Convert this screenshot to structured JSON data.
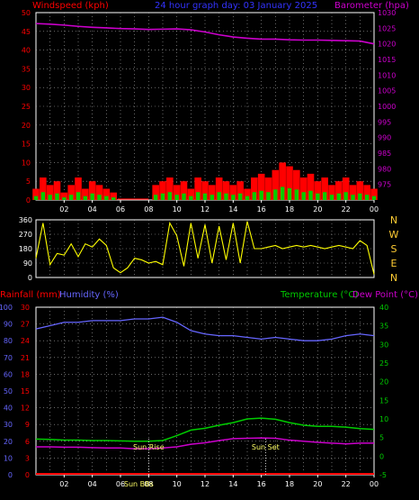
{
  "header": {
    "windspeed_label": "Windspeed (kph)",
    "graph_title": "24 hour graph day: 03 January 2025",
    "barometer_label": "Barometer (hpa)",
    "rainfall_label": "Rainfall (mm)",
    "humidity_label": "Humidity (%)",
    "temperature_label": "Temperature (°C)",
    "dewpoint_label": "Dew Point (°C)",
    "sunrise_label": "Sun Rise",
    "sunset_label": "Sun Set",
    "sunbbs_label": "Sun BBs"
  },
  "colors": {
    "background": "#000000",
    "wind": "#ff0000",
    "gust_fill": "#00cc00",
    "barometer": "#cc00cc",
    "direction": "#ffff00",
    "humidity": "#6666ff",
    "temperature": "#00cc00",
    "dewpoint": "#cc00cc",
    "rainfall": "#ff0000",
    "grid": "#aaaaaa",
    "axis": "#ffffff",
    "compass": "#ffcc33"
  },
  "chart_data": [
    {
      "type": "area",
      "title": "24 hour graph day: 03 January 2025",
      "ylabel": "Windspeed (kph)",
      "y2label": "Barometer (hpa)",
      "ylim": [
        0,
        50
      ],
      "y2lim": [
        970,
        1030
      ],
      "yticks": [
        "0",
        "5",
        "10",
        "15",
        "20",
        "25",
        "30",
        "35",
        "40",
        "45",
        "50"
      ],
      "y2ticks": [
        "975",
        "980",
        "985",
        "990",
        "995",
        "1000",
        "1005",
        "1010",
        "1015",
        "1020",
        "1025",
        "1030"
      ],
      "xticks": [
        "02",
        "04",
        "06",
        "08",
        "10",
        "12",
        "14",
        "16",
        "18",
        "20",
        "22",
        "00"
      ],
      "series": [
        {
          "name": "Windspeed (kph)",
          "x": [
            0,
            0.5,
            1,
            1.5,
            2,
            2.5,
            3,
            3.5,
            4,
            4.5,
            5,
            5.5,
            6,
            6.5,
            7,
            7.5,
            8,
            8.5,
            9,
            9.5,
            10,
            10.5,
            11,
            11.5,
            12,
            12.5,
            13,
            13.5,
            14,
            14.5,
            15,
            15.5,
            16,
            16.5,
            17,
            17.5,
            18,
            18.5,
            19,
            19.5,
            20,
            20.5,
            21,
            21.5,
            22,
            22.5,
            23,
            23.5,
            24
          ],
          "values": [
            3,
            6,
            4,
            5,
            2,
            4,
            6,
            3,
            5,
            4,
            3,
            2,
            0,
            0,
            0,
            0,
            0,
            4,
            5,
            6,
            4,
            5,
            3,
            6,
            5,
            4,
            6,
            5,
            4,
            5,
            3,
            6,
            7,
            6,
            8,
            10,
            9,
            8,
            6,
            7,
            5,
            6,
            4,
            5,
            6,
            4,
            5,
            4,
            3
          ]
        },
        {
          "name": "Barometer (hpa)",
          "x": [
            0,
            1,
            2,
            3,
            4,
            5,
            6,
            7,
            8,
            9,
            10,
            11,
            12,
            13,
            14,
            15,
            16,
            17,
            18,
            19,
            20,
            21,
            22,
            23,
            24
          ],
          "values": [
            1026.5,
            1026.3,
            1026.0,
            1025.6,
            1025.3,
            1025.1,
            1024.9,
            1024.8,
            1024.6,
            1024.7,
            1024.8,
            1024.5,
            1023.8,
            1022.9,
            1022.2,
            1021.8,
            1021.5,
            1021.5,
            1021.3,
            1021.2,
            1021.2,
            1021.1,
            1021.0,
            1020.9,
            1020.0
          ]
        }
      ]
    },
    {
      "type": "line",
      "ylabel": "Wind direction",
      "ylim": [
        0,
        360
      ],
      "yticks": [
        "0",
        "90",
        "180",
        "270",
        "360"
      ],
      "compass": [
        "N",
        "W",
        "S",
        "E",
        "N"
      ],
      "series": [
        {
          "name": "Wind direction",
          "x": [
            0,
            0.5,
            1,
            1.5,
            2,
            2.5,
            3,
            3.5,
            4,
            4.5,
            5,
            5.5,
            6,
            6.5,
            7,
            7.5,
            8,
            8.5,
            9,
            9.5,
            10,
            10.5,
            11,
            11.5,
            12,
            12.5,
            13,
            13.5,
            14,
            14.5,
            15,
            15.5,
            16,
            16.5,
            17,
            17.5,
            18,
            18.5,
            19,
            19.5,
            20,
            20.5,
            21,
            21.5,
            22,
            22.5,
            23,
            23.5,
            24
          ],
          "values": [
            120,
            340,
            80,
            150,
            140,
            210,
            130,
            210,
            190,
            240,
            200,
            60,
            30,
            60,
            120,
            110,
            90,
            100,
            80,
            340,
            260,
            70,
            340,
            120,
            330,
            90,
            320,
            110,
            340,
            90,
            350,
            180,
            180,
            190,
            200,
            180,
            190,
            200,
            190,
            200,
            190,
            180,
            190,
            200,
            190,
            180,
            230,
            200,
            20
          ]
        }
      ]
    },
    {
      "type": "line",
      "ylabel": "Humidity (%)",
      "y2label": "Temperature (°C)",
      "ylim": [
        0,
        100
      ],
      "ylim_rain": [
        0,
        30
      ],
      "y2lim": [
        -5,
        40
      ],
      "yticks": [
        "0",
        "10",
        "20",
        "30",
        "40",
        "50",
        "60",
        "70",
        "80",
        "90",
        "100"
      ],
      "rainticks": [
        "0",
        "3",
        "6",
        "9",
        "12",
        "15",
        "18",
        "21",
        "24",
        "27",
        "30"
      ],
      "y2ticks": [
        "-5",
        "0",
        "5",
        "10",
        "15",
        "20",
        "25",
        "30",
        "35",
        "40"
      ],
      "xticks": [
        "02",
        "04",
        "06",
        "08",
        "10",
        "12",
        "14",
        "16",
        "18",
        "20",
        "22",
        "00"
      ],
      "series": [
        {
          "name": "Humidity (%)",
          "x": [
            0,
            1,
            2,
            3,
            4,
            5,
            6,
            7,
            8,
            9,
            10,
            11,
            12,
            13,
            14,
            15,
            16,
            17,
            18,
            19,
            20,
            21,
            22,
            23,
            24
          ],
          "values": [
            87,
            89,
            91,
            91,
            92,
            92,
            92,
            93,
            93,
            94,
            91,
            86,
            84,
            83,
            83,
            82,
            81,
            82,
            81,
            80,
            80,
            81,
            83,
            84,
            83
          ]
        },
        {
          "name": "Temperature (°C)",
          "x": [
            0,
            1,
            2,
            3,
            4,
            5,
            6,
            7,
            8,
            9,
            10,
            11,
            12,
            13,
            14,
            15,
            16,
            17,
            18,
            19,
            20,
            21,
            22,
            23,
            24
          ],
          "values": [
            4.6,
            4.5,
            4.3,
            4.3,
            4.2,
            4.2,
            4.1,
            4.0,
            4.0,
            4.2,
            5.5,
            7.0,
            7.5,
            8.3,
            9.0,
            10.0,
            10.2,
            9.9,
            9.0,
            8.3,
            8.0,
            8.0,
            7.8,
            7.4,
            7.2
          ]
        },
        {
          "name": "Dew Point (°C)",
          "x": [
            0,
            1,
            2,
            3,
            4,
            5,
            6,
            7,
            8,
            9,
            10,
            11,
            12,
            13,
            14,
            15,
            16,
            17,
            18,
            19,
            20,
            21,
            22,
            23,
            24
          ],
          "values": [
            2.5,
            2.5,
            2.4,
            2.4,
            2.3,
            2.2,
            2.2,
            2.0,
            2.0,
            2.2,
            2.5,
            3.2,
            3.6,
            4.2,
            4.7,
            4.8,
            4.9,
            4.8,
            4.3,
            4.0,
            3.7,
            3.5,
            3.3,
            3.5,
            3.5
          ]
        },
        {
          "name": "Rainfall (mm)",
          "x": [
            0,
            24
          ],
          "values": [
            0,
            0
          ]
        }
      ],
      "annotations": [
        {
          "text": "Sun Rise",
          "x": 8.0
        },
        {
          "text": "Sun Set",
          "x": 16.3
        }
      ]
    }
  ]
}
